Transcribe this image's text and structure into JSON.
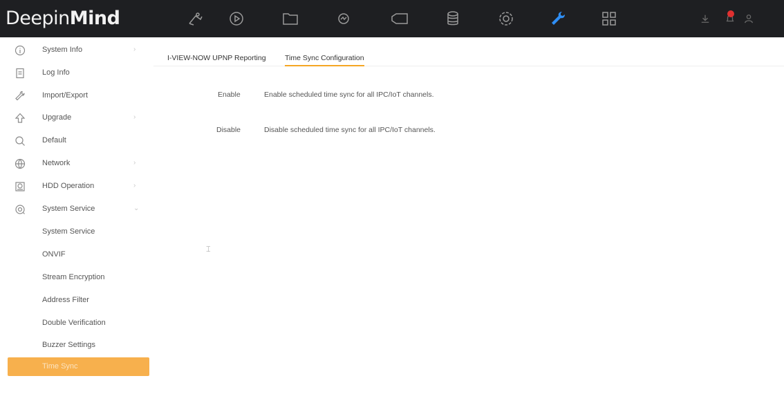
{
  "app": {
    "logo_light": "Deepin",
    "logo_bold": "Mind"
  },
  "topbar": {
    "icons": [
      "live-view-icon",
      "playback-icon",
      "file-management-icon",
      "smart-analysis-icon",
      "channel-icon",
      "storage-icon",
      "configuration-icon",
      "maintenance-icon",
      "multi-screen-icon"
    ],
    "active_icon": "maintenance-icon",
    "right_icons": [
      "download-icon",
      "alarm-icon",
      "user-icon"
    ],
    "accent": "#2f8ef5"
  },
  "sidebar": {
    "items": [
      {
        "label": "System Info",
        "icon": "info-icon",
        "expand": "›"
      },
      {
        "label": "Log Info",
        "icon": "log-icon",
        "expand": ""
      },
      {
        "label": "Import/Export",
        "icon": "wrench-icon",
        "expand": ""
      },
      {
        "label": "Upgrade",
        "icon": "upgrade-icon",
        "expand": "›"
      },
      {
        "label": "Default",
        "icon": "default-icon",
        "expand": ""
      },
      {
        "label": "Network",
        "icon": "network-icon",
        "expand": "›"
      },
      {
        "label": "HDD Operation",
        "icon": "hdd-icon",
        "expand": "›"
      },
      {
        "label": "System Service",
        "icon": "service-icon",
        "expand": "⌄"
      }
    ],
    "sub_items": [
      {
        "label": "System Service"
      },
      {
        "label": "ONVIF"
      },
      {
        "label": "Stream Encryption"
      },
      {
        "label": "Address Filter"
      },
      {
        "label": "Double Verification"
      },
      {
        "label": "Buzzer Settings"
      }
    ],
    "active_sub": "Time Sync",
    "active_color": "#f7b04d"
  },
  "tabs": [
    {
      "label": "I-VIEW-NOW UPNP Reporting",
      "active": false
    },
    {
      "label": "Time Sync Configuration",
      "active": true
    }
  ],
  "content": {
    "rows": [
      {
        "label": "Enable",
        "description": "Enable scheduled time sync for all IPC/IoT channels."
      },
      {
        "label": "Disable",
        "description": "Disable scheduled time sync for all IPC/IoT channels."
      }
    ]
  }
}
